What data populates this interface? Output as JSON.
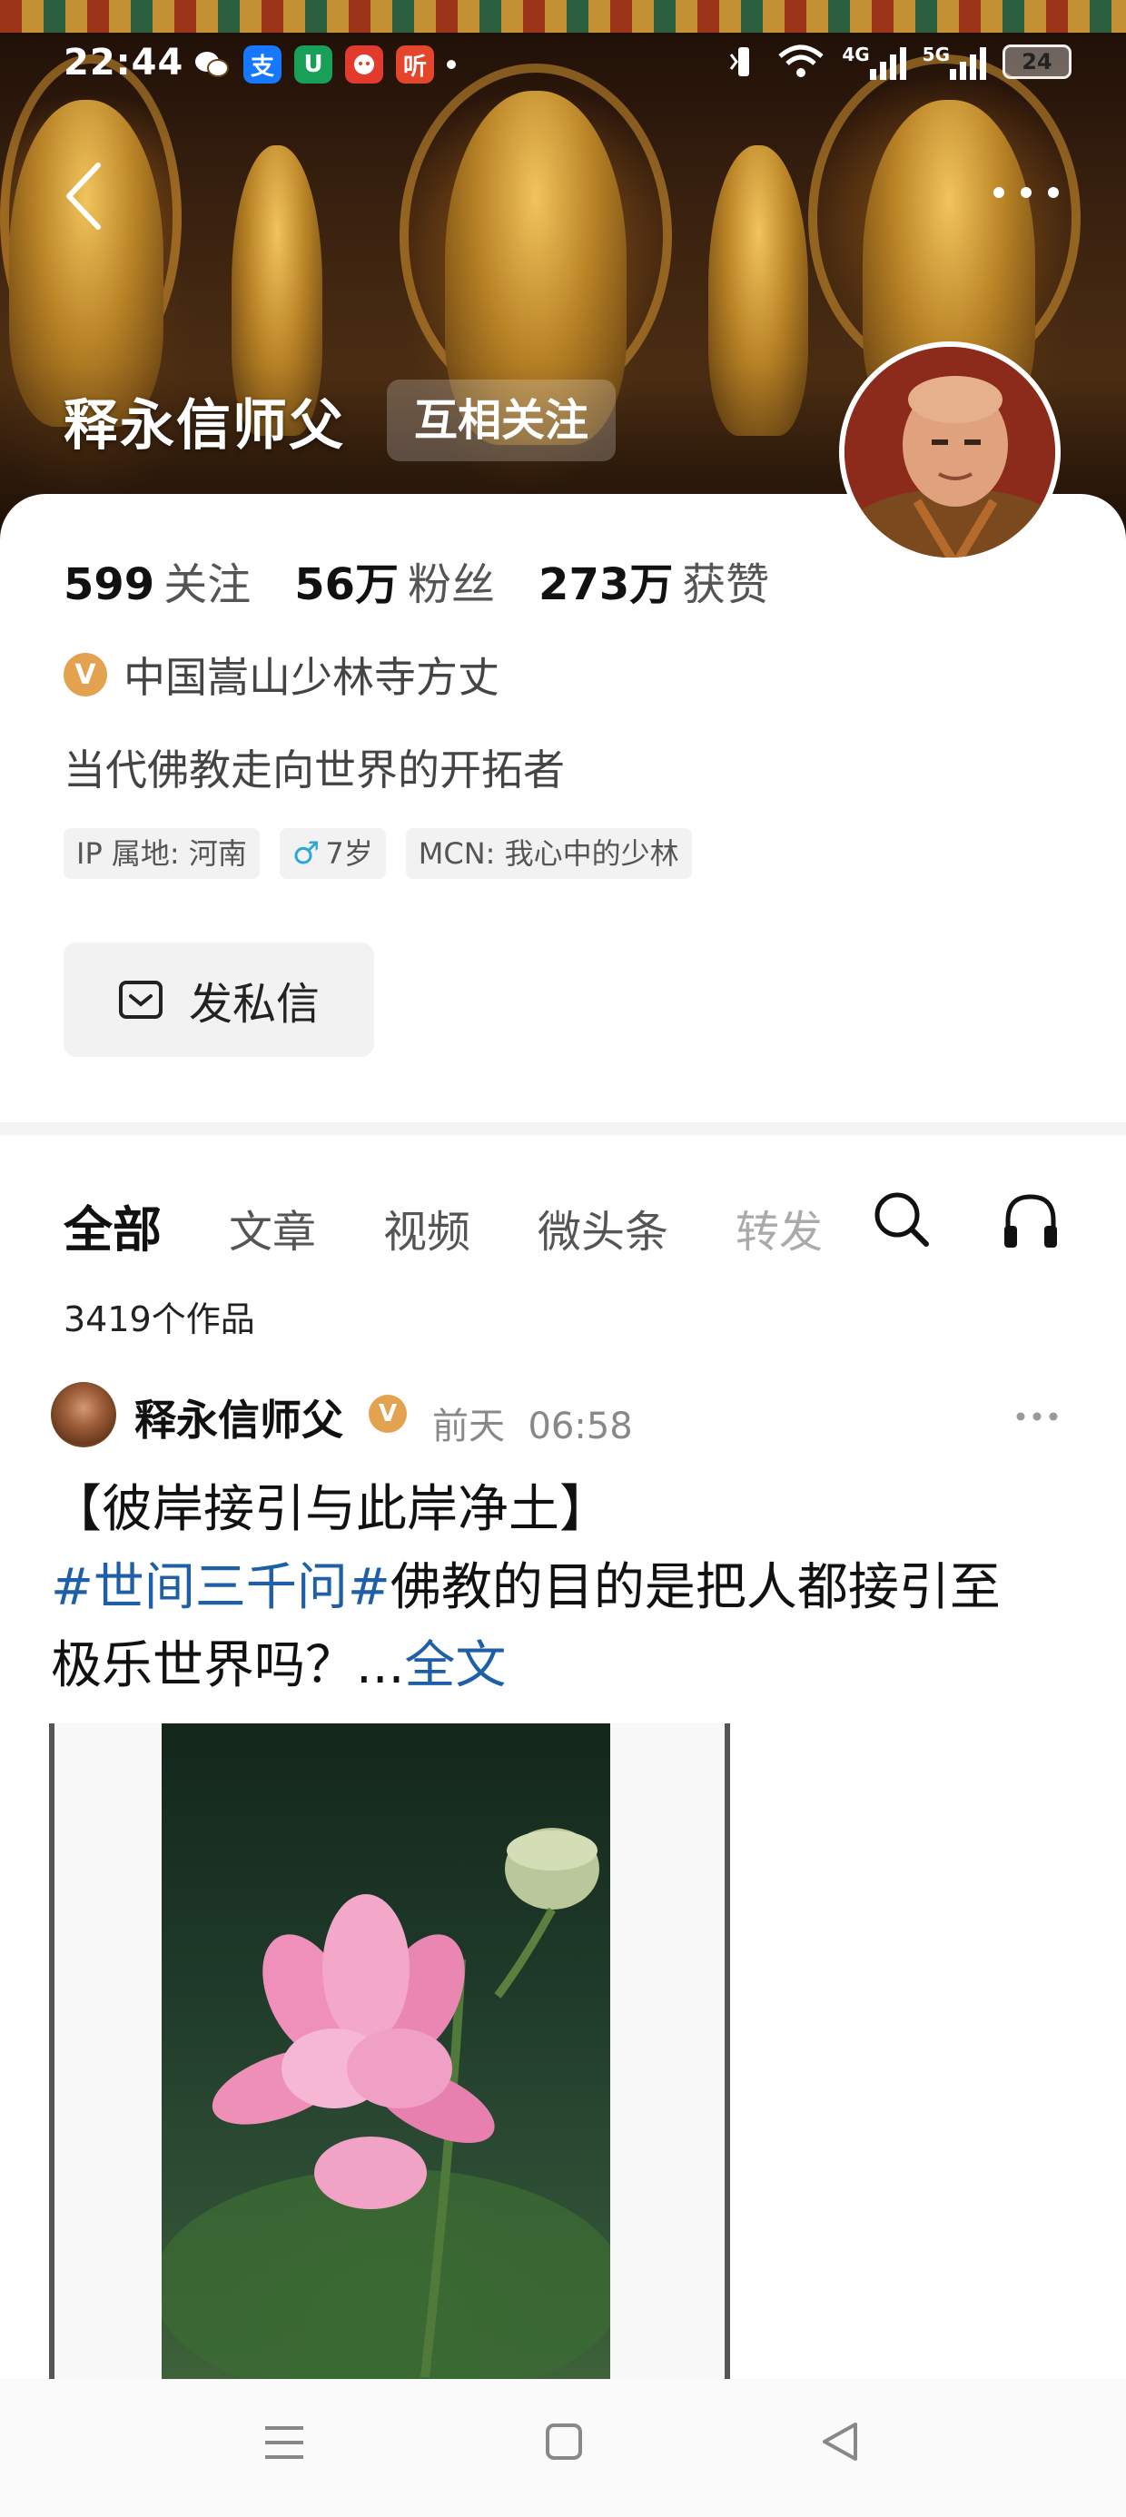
{
  "status_bar": {
    "time": "22:44",
    "apps": [
      {
        "icon": "wechat-icon",
        "glyph": "◉",
        "bg": "transparent"
      },
      {
        "icon": "alipay-icon",
        "glyph": "支",
        "bg": "#1677ff"
      },
      {
        "icon": "app-green-icon",
        "glyph": "U",
        "bg": "#18a058"
      },
      {
        "icon": "app-red-icon",
        "glyph": "●",
        "bg": "#e23b2e"
      },
      {
        "icon": "ting-icon",
        "glyph": "听",
        "bg": "#e4462b"
      }
    ],
    "network_4g": "4G",
    "network_5g": "5G",
    "battery": "24"
  },
  "profile": {
    "name": "释永信师父",
    "follow_state": "互相关注",
    "stats": [
      {
        "value": "599",
        "label": "关注"
      },
      {
        "value": "56万",
        "label": "粉丝"
      },
      {
        "value": "273万",
        "label": "获赞"
      }
    ],
    "verified_badge": "V",
    "verified_text": "中国嵩山少林寺方丈",
    "bio": "当代佛教走向世界的开拓者",
    "tags": {
      "ip": "IP 属地: 河南",
      "gender_symbol": "♂",
      "age": "7岁",
      "mcn": "MCN: 我心中的少林"
    },
    "dm_label": "发私信"
  },
  "tabs": [
    {
      "label": "全部",
      "active": true
    },
    {
      "label": "文章",
      "active": false
    },
    {
      "label": "视频",
      "active": false
    },
    {
      "label": "微头条",
      "active": false
    },
    {
      "label": "转发",
      "active": false
    }
  ],
  "works_count": "3419个作品",
  "post": {
    "author": "释永信师父",
    "verified_badge": "V",
    "day": "前天",
    "time": "06:58",
    "title": "【彼岸接引与此岸净土】",
    "hashtag": "#世间三千问#",
    "body_1": "佛教的目的是把人都接引至",
    "body_2": "极乐世界吗？...",
    "more_link": "全文"
  },
  "colors": {
    "link_blue": "#1e5fa8",
    "verified_gold": "#e3a250",
    "lotus_pink": "#ee8fb8"
  }
}
